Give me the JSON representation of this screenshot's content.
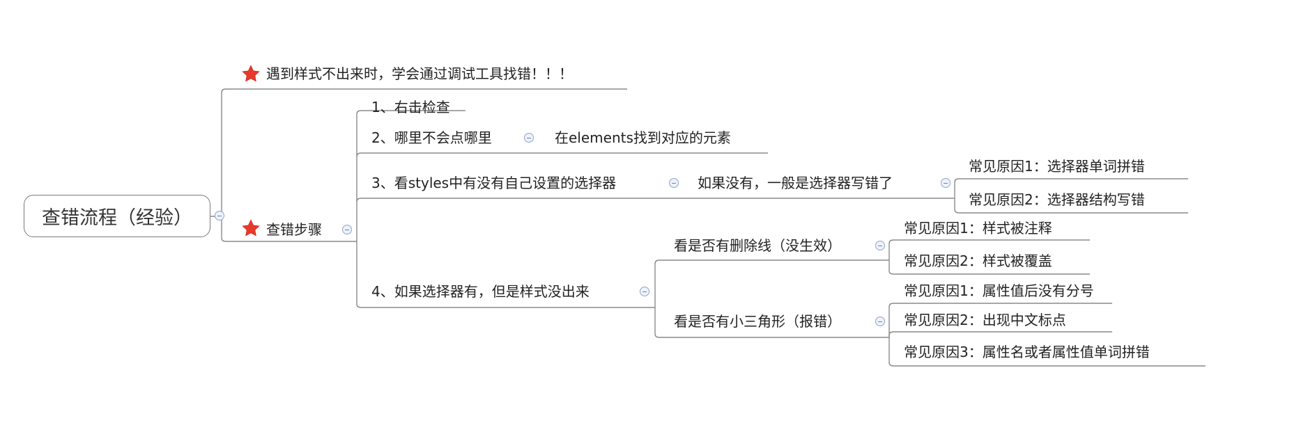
{
  "root": {
    "label": "查错流程（经验）"
  },
  "branch_top": {
    "label": "遇到样式不出来时，学会通过调试工具找错！！！",
    "icon": "star-icon"
  },
  "branch_steps": {
    "label": "查错步骤",
    "icon": "star-icon"
  },
  "steps": [
    {
      "label": "1、右击检查"
    },
    {
      "label": "2、哪里不会点哪里",
      "child": "在elements找到对应的元素"
    },
    {
      "label": "3、看styles中有没有自己设置的选择器",
      "child": "如果没有，一般是选择器写错了",
      "causes": [
        "常见原因1：选择器单词拼错",
        "常见原因2：选择器结构写错"
      ]
    },
    {
      "label": "4、如果选择器有，但是样式没出来",
      "subs": [
        {
          "label": "看是否有删除线（没生效）",
          "causes": [
            "常见原因1：样式被注释",
            "常见原因2：样式被覆盖"
          ]
        },
        {
          "label": "看是否有小三角形（报错）",
          "causes": [
            "常见原因1：属性值后没有分号",
            "常见原因2：出现中文标点",
            "常见原因3：属性名或者属性值单词拼错"
          ]
        }
      ]
    }
  ],
  "colors": {
    "line": "#7f7f7f",
    "star": "#e8392b",
    "collapse": "#6a82b3"
  }
}
